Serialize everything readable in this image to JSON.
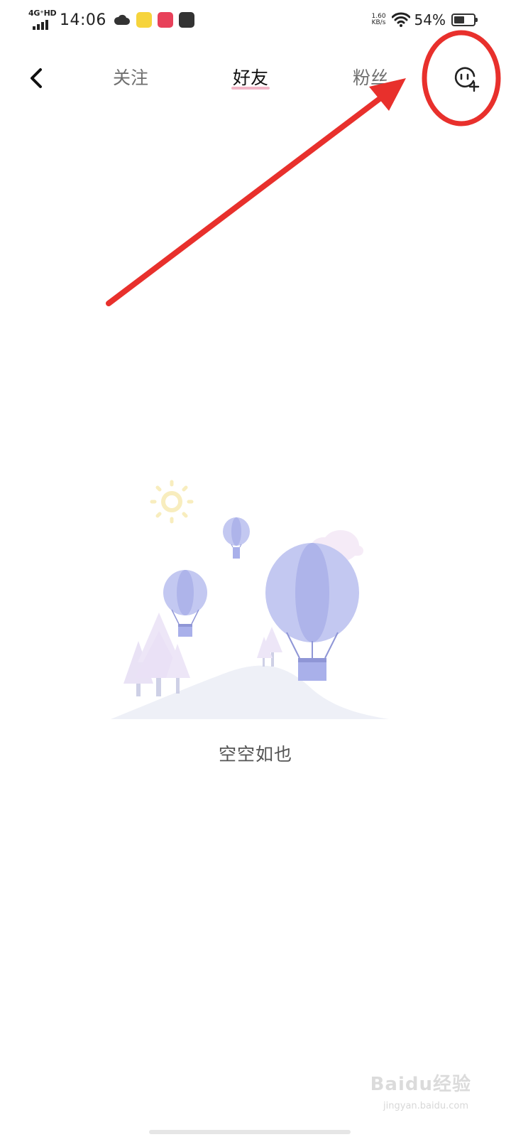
{
  "status_bar": {
    "network": "4G⁺HD",
    "time": "14:06",
    "speed_value": "1.60",
    "speed_unit": "KB/s",
    "battery": "54%",
    "battery_level": 0.54
  },
  "nav": {
    "tabs": [
      {
        "label": "关注"
      },
      {
        "label": "好友",
        "active": true
      },
      {
        "label": "粉丝"
      }
    ]
  },
  "empty_state": {
    "text": "空空如也"
  },
  "watermark": {
    "brand": "Baidu经验",
    "url": "jingyan.baidu.com"
  },
  "colors": {
    "annotation_red": "#e8302c",
    "tab_underline": "#f2b6c7",
    "balloon": "#a9b0ea"
  },
  "icons": {
    "back": "chevron-left-icon",
    "add_friend": "add-friend-icon",
    "wifi": "wifi-icon",
    "battery": "battery-icon"
  }
}
